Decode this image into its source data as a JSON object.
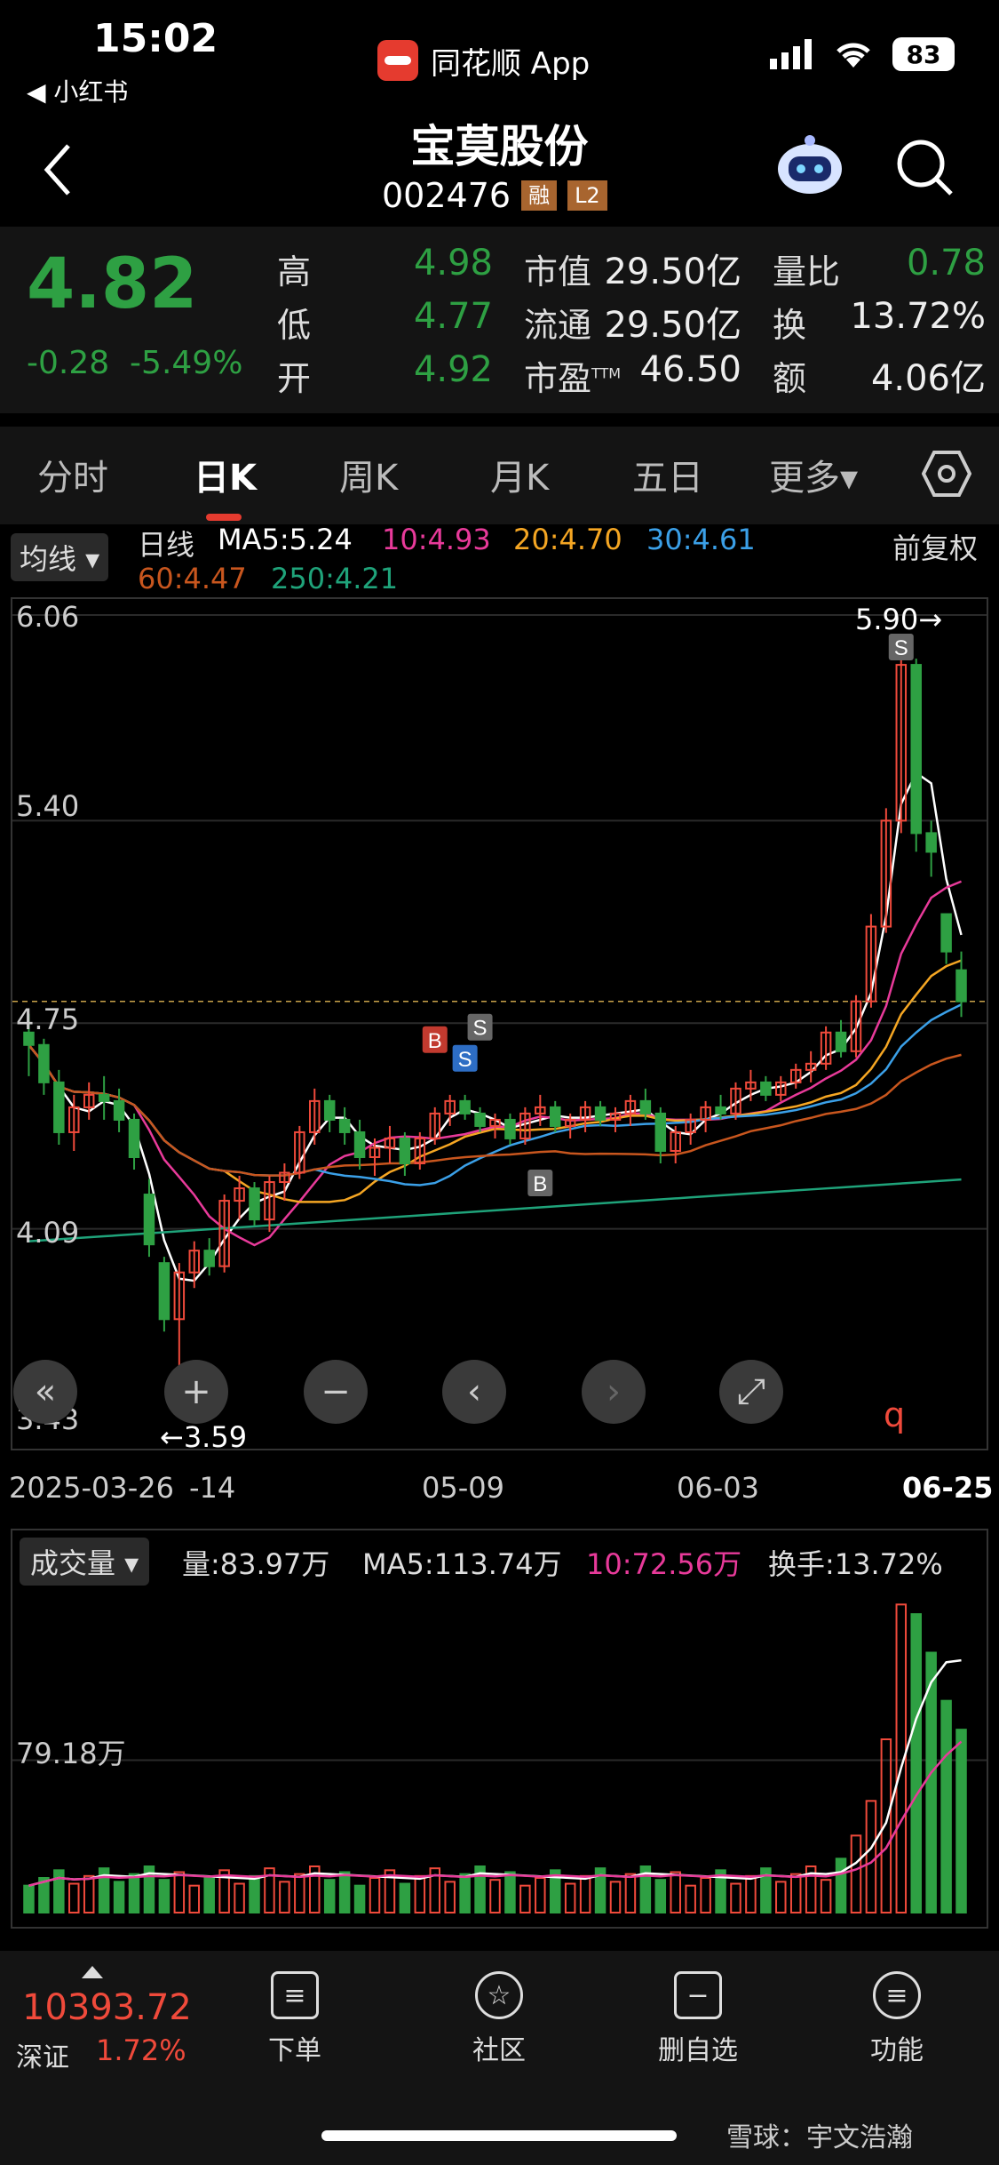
{
  "status": {
    "time": "15:02",
    "back_app": "◀ 小红书",
    "app_name": "同花顺 App",
    "battery": "83"
  },
  "header": {
    "title": "宝莫股份",
    "code": "002476",
    "tag_rong": "融",
    "tag_l2": "L2"
  },
  "quote": {
    "price": "4.82",
    "change": "-0.28",
    "change_pct": "-5.49%",
    "high_label": "高",
    "high": "4.98",
    "low_label": "低",
    "low": "4.77",
    "open_label": "开",
    "open": "4.92",
    "mcap_label": "市值",
    "mcap": "29.50亿",
    "float_label": "流通",
    "float": "29.50亿",
    "pe_label": "市盈",
    "pe_sup": "TTM",
    "pe": "46.50",
    "vr_label": "量比",
    "vr": "0.78",
    "turn_label": "换",
    "turn": "13.72%",
    "amt_label": "额",
    "amt": "4.06亿"
  },
  "tabs": [
    "分时",
    "日K",
    "周K",
    "月K",
    "五日",
    "更多▾"
  ],
  "ma": {
    "selector": "均线 ▾",
    "daily": "日线",
    "ma5": "MA5:5.24",
    "ma10": "10:4.93",
    "ma20": "20:4.70",
    "ma30": "30:4.61",
    "ma60": "60:4.47",
    "ma250": "4.21",
    "ma250_label": "250:",
    "adjust": "前复权"
  },
  "price_axis": [
    "6.06",
    "5.40",
    "4.75",
    "4.09",
    "3.43"
  ],
  "annotations": {
    "high": "5.90→",
    "low": "←3.59",
    "b": "B",
    "s": "S",
    "q": "q"
  },
  "date_axis": [
    "2025-03-26",
    "-14",
    "05-09",
    "06-03",
    "06-25"
  ],
  "volume": {
    "selector": "成交量 ▾",
    "vol": "量:83.97万",
    "ma5": "MA5:113.74万",
    "ma10": "10:72.56万",
    "turn": "换手:13.72%",
    "axis": "79.18万"
  },
  "bottom": {
    "index_value": "10393.72",
    "index_name": "深证",
    "index_pct": "1.72%",
    "order": "下单",
    "community": "社区",
    "remove": "删自选",
    "functions": "功能",
    "watermark": "雪球：宇文浩瀚"
  },
  "colors": {
    "up": "#f04a3b",
    "down": "#2ea043",
    "ma5": "#ffffff",
    "ma10": "#e83a9a",
    "ma20": "#f5a623",
    "ma30": "#3ba0e8",
    "ma60": "#c8561e",
    "ma250": "#1fa37a"
  },
  "chart_data": {
    "type": "candlestick",
    "ylim": [
      3.43,
      6.06
    ],
    "candles": [
      [
        4.72,
        4.78,
        4.58,
        4.68
      ],
      [
        4.68,
        4.7,
        4.52,
        4.56
      ],
      [
        4.56,
        4.6,
        4.36,
        4.4
      ],
      [
        4.4,
        4.52,
        4.34,
        4.48
      ],
      [
        4.48,
        4.56,
        4.44,
        4.52
      ],
      [
        4.52,
        4.58,
        4.44,
        4.5
      ],
      [
        4.5,
        4.54,
        4.4,
        4.44
      ],
      [
        4.44,
        4.46,
        4.28,
        4.32
      ],
      [
        4.2,
        4.25,
        4.0,
        4.04
      ],
      [
        3.98,
        4.0,
        3.76,
        3.8
      ],
      [
        3.8,
        3.98,
        3.59,
        3.95
      ],
      [
        3.95,
        4.05,
        3.9,
        4.02
      ],
      [
        4.02,
        4.06,
        3.94,
        3.97
      ],
      [
        3.97,
        4.2,
        3.95,
        4.18
      ],
      [
        4.18,
        4.26,
        4.12,
        4.22
      ],
      [
        4.22,
        4.24,
        4.1,
        4.12
      ],
      [
        4.12,
        4.26,
        4.08,
        4.24
      ],
      [
        4.24,
        4.3,
        4.18,
        4.27
      ],
      [
        4.27,
        4.42,
        4.25,
        4.4
      ],
      [
        4.4,
        4.54,
        4.36,
        4.5
      ],
      [
        4.5,
        4.52,
        4.4,
        4.44
      ],
      [
        4.44,
        4.48,
        4.36,
        4.4
      ],
      [
        4.4,
        4.44,
        4.28,
        4.32
      ],
      [
        4.32,
        4.38,
        4.26,
        4.35
      ],
      [
        4.35,
        4.42,
        4.3,
        4.38
      ],
      [
        4.38,
        4.4,
        4.26,
        4.3
      ],
      [
        4.3,
        4.4,
        4.28,
        4.38
      ],
      [
        4.38,
        4.48,
        4.36,
        4.46
      ],
      [
        4.46,
        4.52,
        4.42,
        4.5
      ],
      [
        4.5,
        4.52,
        4.44,
        4.46
      ],
      [
        4.46,
        4.48,
        4.4,
        4.42
      ],
      [
        4.42,
        4.46,
        4.38,
        4.44
      ],
      [
        4.44,
        4.46,
        4.36,
        4.38
      ],
      [
        4.38,
        4.48,
        4.36,
        4.46
      ],
      [
        4.46,
        4.52,
        4.42,
        4.48
      ],
      [
        4.48,
        4.5,
        4.4,
        4.42
      ],
      [
        4.42,
        4.46,
        4.38,
        4.44
      ],
      [
        4.44,
        4.5,
        4.4,
        4.48
      ],
      [
        4.48,
        4.5,
        4.42,
        4.44
      ],
      [
        4.44,
        4.48,
        4.4,
        4.46
      ],
      [
        4.46,
        4.52,
        4.42,
        4.5
      ],
      [
        4.5,
        4.54,
        4.44,
        4.46
      ],
      [
        4.46,
        4.48,
        4.3,
        4.34
      ],
      [
        4.34,
        4.42,
        4.3,
        4.4
      ],
      [
        4.4,
        4.46,
        4.36,
        4.44
      ],
      [
        4.44,
        4.5,
        4.4,
        4.48
      ],
      [
        4.48,
        4.52,
        4.44,
        4.46
      ],
      [
        4.46,
        4.56,
        4.44,
        4.54
      ],
      [
        4.54,
        4.6,
        4.5,
        4.56
      ],
      [
        4.56,
        4.58,
        4.5,
        4.52
      ],
      [
        4.52,
        4.58,
        4.5,
        4.56
      ],
      [
        4.56,
        4.62,
        4.54,
        4.6
      ],
      [
        4.6,
        4.66,
        4.56,
        4.62
      ],
      [
        4.62,
        4.74,
        4.6,
        4.72
      ],
      [
        4.72,
        4.76,
        4.64,
        4.66
      ],
      [
        4.66,
        4.84,
        4.64,
        4.82
      ],
      [
        4.82,
        5.1,
        4.8,
        5.06
      ],
      [
        5.06,
        5.44,
        5.04,
        5.4
      ],
      [
        5.4,
        5.94,
        5.36,
        5.9
      ],
      [
        5.9,
        5.92,
        5.3,
        5.36
      ],
      [
        5.36,
        5.4,
        5.22,
        5.3
      ],
      [
        5.1,
        5.1,
        4.94,
        4.98
      ],
      [
        4.92,
        4.98,
        4.77,
        4.82
      ]
    ],
    "volume_ylim": [
      0,
      180
    ]
  }
}
